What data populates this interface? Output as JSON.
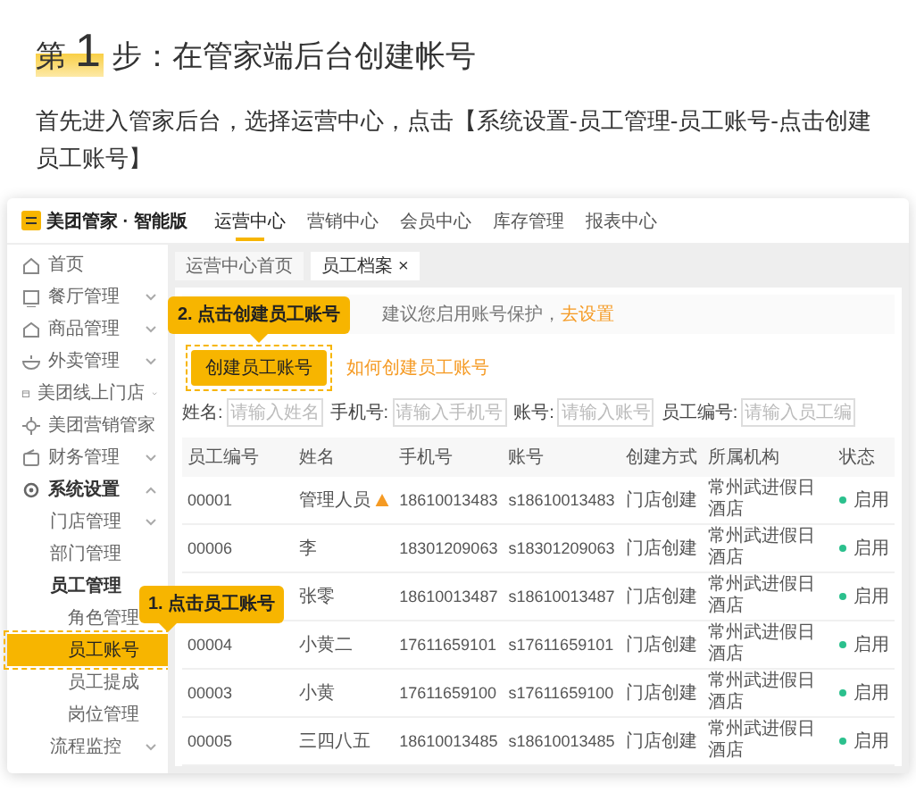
{
  "step": {
    "label": "第",
    "number": "1",
    "title": "步：在管家端后台创建帐号"
  },
  "intro": "首先进入管家后台，选择运营中心，点击【系统设置-员工管理-员工账号-点击创建员工账号】",
  "admin": {
    "brand": "美团管家 · 智能版",
    "top_nav": [
      {
        "label": "运营中心",
        "selected": true
      },
      {
        "label": "营销中心",
        "selected": false
      },
      {
        "label": "会员中心",
        "selected": false
      },
      {
        "label": "库存管理",
        "selected": false
      },
      {
        "label": "报表中心",
        "selected": false
      }
    ],
    "sidebar": {
      "items": [
        {
          "label": "首页",
          "kind": "link",
          "selected": false
        },
        {
          "label": "餐厅管理",
          "kind": "group",
          "expanded": false,
          "selected": false
        },
        {
          "label": "商品管理",
          "kind": "group",
          "expanded": false,
          "selected": false
        },
        {
          "label": "外卖管理",
          "kind": "group",
          "expanded": false,
          "selected": false
        },
        {
          "label": "美团线上门店",
          "kind": "group",
          "expanded": false,
          "selected": false
        },
        {
          "label": "美团营销管家",
          "kind": "link",
          "selected": false
        },
        {
          "label": "财务管理",
          "kind": "group",
          "expanded": false,
          "selected": false
        },
        {
          "label": "系统设置",
          "kind": "group",
          "expanded": true,
          "selected": false,
          "children": [
            {
              "label": "门店管理",
              "kind": "group",
              "expanded": false,
              "selected": false
            },
            {
              "label": "部门管理",
              "kind": "link",
              "selected": false
            },
            {
              "label": "员工管理",
              "kind": "heading",
              "selected": false,
              "children": [
                {
                  "label": "角色管理",
                  "kind": "link",
                  "selected": false
                },
                {
                  "label": "员工账号",
                  "kind": "link",
                  "selected": true
                },
                {
                  "label": "员工提成",
                  "kind": "link",
                  "selected": false
                },
                {
                  "label": "岗位管理",
                  "kind": "link",
                  "selected": false
                }
              ]
            },
            {
              "label": "流程监控",
              "kind": "group",
              "expanded": false,
              "selected": false
            }
          ]
        }
      ]
    },
    "tabs": [
      {
        "label": "运营中心首页",
        "selected": false,
        "closable": false
      },
      {
        "label": "员工档案",
        "selected": true,
        "closable": true,
        "close": "×"
      }
    ],
    "notice": {
      "text": "建议您启用账号保护，",
      "link": "去设置"
    },
    "create_button": "创建员工账号",
    "help_link": "如何创建员工账号",
    "filters": [
      {
        "label": "姓名:",
        "placeholder": "请输入姓名"
      },
      {
        "label": "手机号:",
        "placeholder": "请输入手机号"
      },
      {
        "label": "账号:",
        "placeholder": "请输入账号"
      },
      {
        "label": "员工编号:",
        "placeholder": "请输入员工编"
      }
    ],
    "table": {
      "columns": [
        "员工编号",
        "姓名",
        "手机号",
        "账号",
        "创建方式",
        "所属机构",
        "状态"
      ],
      "rows": [
        {
          "id": "00001",
          "name": "管理人员",
          "warning": true,
          "phone": "18610013483",
          "account": "s18610013483",
          "source": "门店创建",
          "org": "常州武进假日酒店",
          "status": "启用"
        },
        {
          "id": "00006",
          "name": "李",
          "warning": false,
          "phone": "18301209063",
          "account": "s18301209063",
          "source": "门店创建",
          "org": "常州武进假日酒店",
          "status": "启用"
        },
        {
          "name": "张零",
          "warning": false,
          "phone": "18610013487",
          "account": "s18610013487",
          "source": "门店创建",
          "org": "常州武进假日酒店",
          "status": "启用"
        },
        {
          "id": "00004",
          "name": "小黄二",
          "warning": false,
          "phone": "17611659101",
          "account": "s17611659101",
          "source": "门店创建",
          "org": "常州武进假日酒店",
          "status": "启用"
        },
        {
          "id": "00003",
          "name": "小黄",
          "warning": false,
          "phone": "17611659100",
          "account": "s17611659100",
          "source": "门店创建",
          "org": "常州武进假日酒店",
          "status": "启用"
        },
        {
          "id": "00005",
          "name": "三四八五",
          "warning": false,
          "phone": "18610013485",
          "account": "s18610013485",
          "source": "门店创建",
          "org": "常州武进假日酒店",
          "status": "启用"
        }
      ]
    },
    "callouts": [
      {
        "text": "2. 点击创建员工账号"
      },
      {
        "text": "1. 点击员工账号"
      }
    ]
  }
}
